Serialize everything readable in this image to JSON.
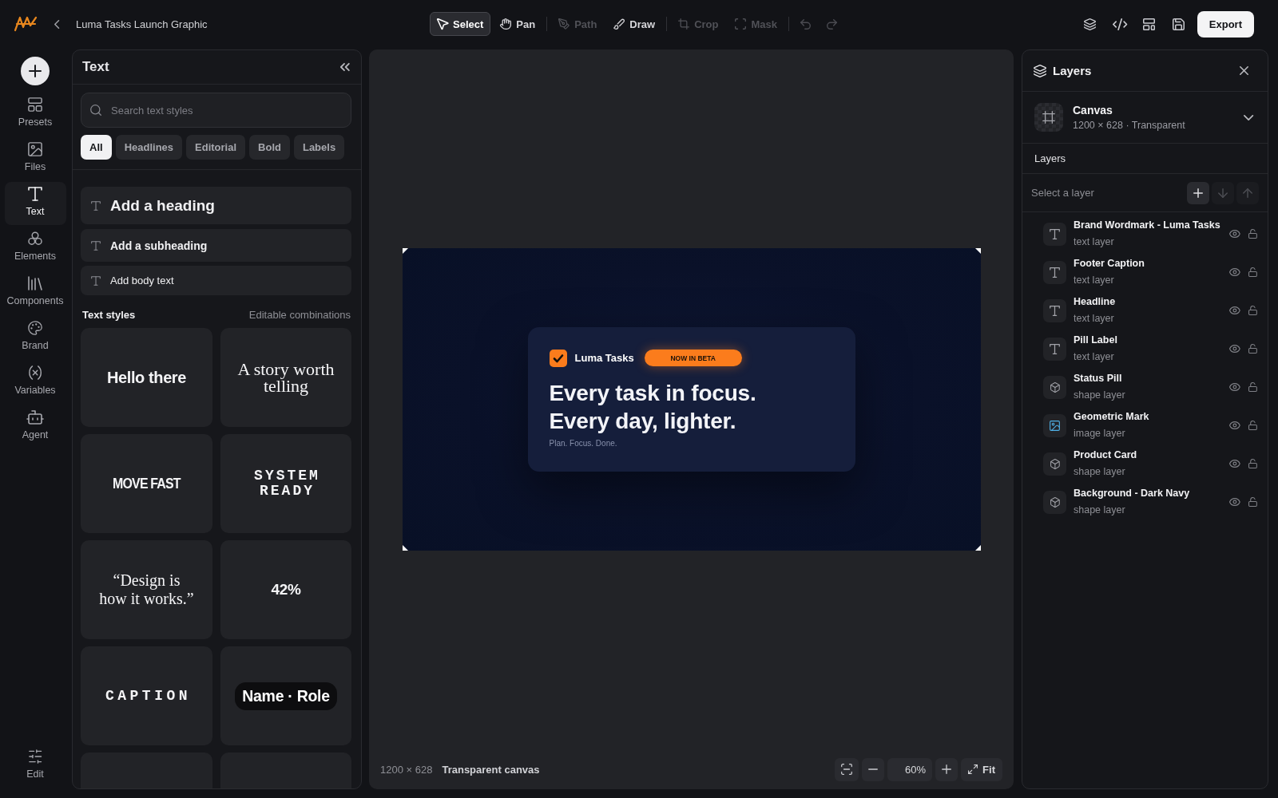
{
  "top_bar": {
    "title": "Luma Tasks Launch Graphic",
    "tool_groups": [
      [
        {
          "label": "Select",
          "selected": true,
          "disabled": false
        },
        {
          "label": "Pan",
          "selected": false,
          "disabled": false
        }
      ],
      [
        {
          "label": "Path",
          "selected": false,
          "disabled": true
        },
        {
          "label": "Draw",
          "selected": false,
          "disabled": false
        }
      ],
      [
        {
          "label": "Crop",
          "selected": false,
          "disabled": true
        },
        {
          "label": "Mask",
          "selected": false,
          "disabled": true
        }
      ]
    ],
    "undo": {
      "disabled": true
    },
    "redo": {
      "disabled": true
    },
    "export_label": "Export"
  },
  "rail": {
    "items": [
      {
        "label": "Presets",
        "selected": false
      },
      {
        "label": "Files",
        "selected": false
      },
      {
        "label": "Text",
        "selected": true
      },
      {
        "label": "Elements",
        "selected": false
      },
      {
        "label": "Components",
        "selected": false
      },
      {
        "label": "Brand",
        "selected": false
      },
      {
        "label": "Variables",
        "selected": false
      },
      {
        "label": "Agent",
        "selected": false
      }
    ],
    "footer_item": {
      "label": "Edit",
      "selected": false
    }
  },
  "text_panel": {
    "title": "Text",
    "search": {
      "placeholder": "Search text styles"
    },
    "filters": [
      {
        "label": "All",
        "selected": true
      },
      {
        "label": "Headlines",
        "selected": false
      },
      {
        "label": "Editorial",
        "selected": false
      },
      {
        "label": "Bold",
        "selected": false
      },
      {
        "label": "Labels",
        "selected": false
      }
    ],
    "quick_add": [
      {
        "label": "Add a heading",
        "kind": "heading"
      },
      {
        "label": "Add a subheading",
        "kind": "subheading"
      },
      {
        "label": "Add body text",
        "kind": "body"
      }
    ],
    "styles_heading": "Text styles",
    "styles_hint": "Editable combinations",
    "style_cards": [
      {
        "kind": "sans",
        "text": "Hello there"
      },
      {
        "kind": "serif",
        "text": "A story worth telling"
      },
      {
        "kind": "condensed",
        "text": "MOVE FAST"
      },
      {
        "kind": "mono",
        "text": "SYSTEM READY"
      },
      {
        "kind": "quote",
        "text": "“Design is how it works.”"
      },
      {
        "kind": "numeric",
        "text": "42%"
      },
      {
        "kind": "caption",
        "text": "CAPTION"
      },
      {
        "kind": "pill",
        "text": "Name · Role"
      },
      {
        "kind": "cut-off"
      },
      {
        "kind": "cut-off"
      }
    ]
  },
  "canvas": {
    "artboard": {
      "brand": "Luma Tasks",
      "badge": "NOW IN BETA",
      "headline": "Every task in focus. Every day, lighter.",
      "tagline": "Plan. Focus. Done."
    },
    "size": "1200 × 628",
    "background": "Transparent canvas",
    "zoom": "60%",
    "fit_label": "Fit"
  },
  "layers_panel": {
    "title": "Layers",
    "canvas": {
      "name": "Canvas",
      "details": "1200 × 628 · Transparent"
    },
    "section_label": "Layers",
    "select_prompt": "Select a layer",
    "actions": [
      {
        "disabled": false
      },
      {
        "disabled": true
      },
      {
        "disabled": true
      }
    ],
    "layers": [
      {
        "name": "Brand Wordmark - Luma Tasks",
        "type": "text layer",
        "kind": "text",
        "visible": true,
        "locked": false
      },
      {
        "name": "Footer Caption",
        "type": "text layer",
        "kind": "text",
        "visible": true,
        "locked": false
      },
      {
        "name": "Headline",
        "type": "text layer",
        "kind": "text",
        "visible": true,
        "locked": false
      },
      {
        "name": "Pill Label",
        "type": "text layer",
        "kind": "text",
        "visible": true,
        "locked": false
      },
      {
        "name": "Status Pill",
        "type": "shape layer",
        "kind": "shape",
        "visible": true,
        "locked": false
      },
      {
        "name": "Geometric Mark",
        "type": "image layer",
        "kind": "image",
        "visible": true,
        "locked": false
      },
      {
        "name": "Product Card",
        "type": "shape layer",
        "kind": "shape",
        "visible": true,
        "locked": false
      },
      {
        "name": "Background - Dark Navy",
        "type": "shape layer",
        "kind": "shape",
        "visible": true,
        "locked": false
      }
    ]
  }
}
